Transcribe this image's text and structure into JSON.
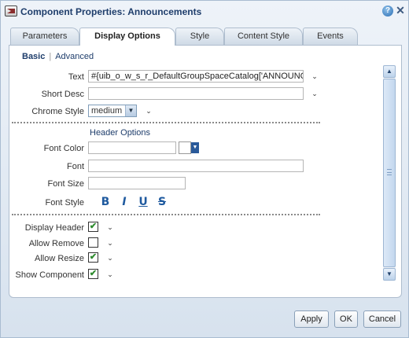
{
  "dialog": {
    "title": "Component Properties: Announcements",
    "help_glyph": "?",
    "close_glyph": "✕"
  },
  "tabs": [
    {
      "label": "Parameters"
    },
    {
      "label": "Display Options",
      "active": true
    },
    {
      "label": "Style"
    },
    {
      "label": "Content Style"
    },
    {
      "label": "Events"
    }
  ],
  "subnav": {
    "basic": "Basic",
    "separator": "|",
    "advanced": "Advanced"
  },
  "fields": {
    "text": {
      "label": "Text",
      "value": "#{uib_o_w_s_r_DefaultGroupSpaceCatalog['ANNOUNC"
    },
    "short_desc": {
      "label": "Short Desc",
      "value": ""
    },
    "chrome_style": {
      "label": "Chrome Style",
      "value": "medium"
    }
  },
  "header_options": {
    "title": "Header Options",
    "font_color": {
      "label": "Font Color",
      "value": ""
    },
    "font": {
      "label": "Font",
      "value": ""
    },
    "font_size": {
      "label": "Font Size",
      "value": ""
    },
    "font_style": {
      "label": "Font Style",
      "bold": "B",
      "italic": "I",
      "underline": "U",
      "strike": "S"
    }
  },
  "checkboxes": [
    {
      "label": "Display Header",
      "checked": true
    },
    {
      "label": "Allow Remove",
      "checked": false
    },
    {
      "label": "Allow Resize",
      "checked": true
    },
    {
      "label": "Show Component",
      "checked": true
    }
  ],
  "check_glyph": "✔",
  "chevron_glyph": "⌄",
  "footer": {
    "apply": "Apply",
    "ok": "OK",
    "cancel": "Cancel"
  },
  "colors": {
    "accent": "#1e3d6b",
    "check": "#2e8b2e",
    "style_icon": "#1f5a9f"
  }
}
